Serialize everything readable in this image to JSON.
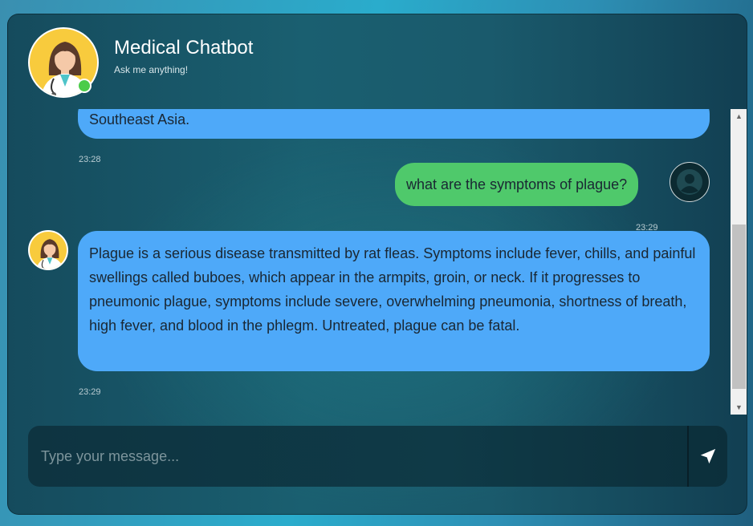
{
  "header": {
    "title": "Medical Chatbot",
    "subtitle": "Ask me anything!",
    "status_color": "#4ccc4a"
  },
  "messages": [
    {
      "role": "bot",
      "text": "Southeast Asia.",
      "time": "23:28"
    },
    {
      "role": "user",
      "text": "what are the symptoms of plague?",
      "time": "23:29"
    },
    {
      "role": "bot",
      "text": "Plague is a serious disease transmitted by rat fleas. Symptoms include fever, chills, and painful swellings called buboes, which appear in the armpits, groin, or neck. If it progresses to pneumonic plague, symptoms include severe, overwhelming pneumonia, shortness of breath, high fever, and blood in the phlegm. Untreated, plague can be fatal.",
      "time": "23:29"
    }
  ],
  "input": {
    "placeholder": "Type your message...",
    "value": ""
  },
  "icons": {
    "send": "paper-plane-icon",
    "user": "user-icon",
    "doctor": "doctor-avatar"
  },
  "colors": {
    "bot_bubble": "#4ea9f9",
    "user_bubble": "#4fc96b",
    "avatar_bg": "#f8cb3d"
  }
}
